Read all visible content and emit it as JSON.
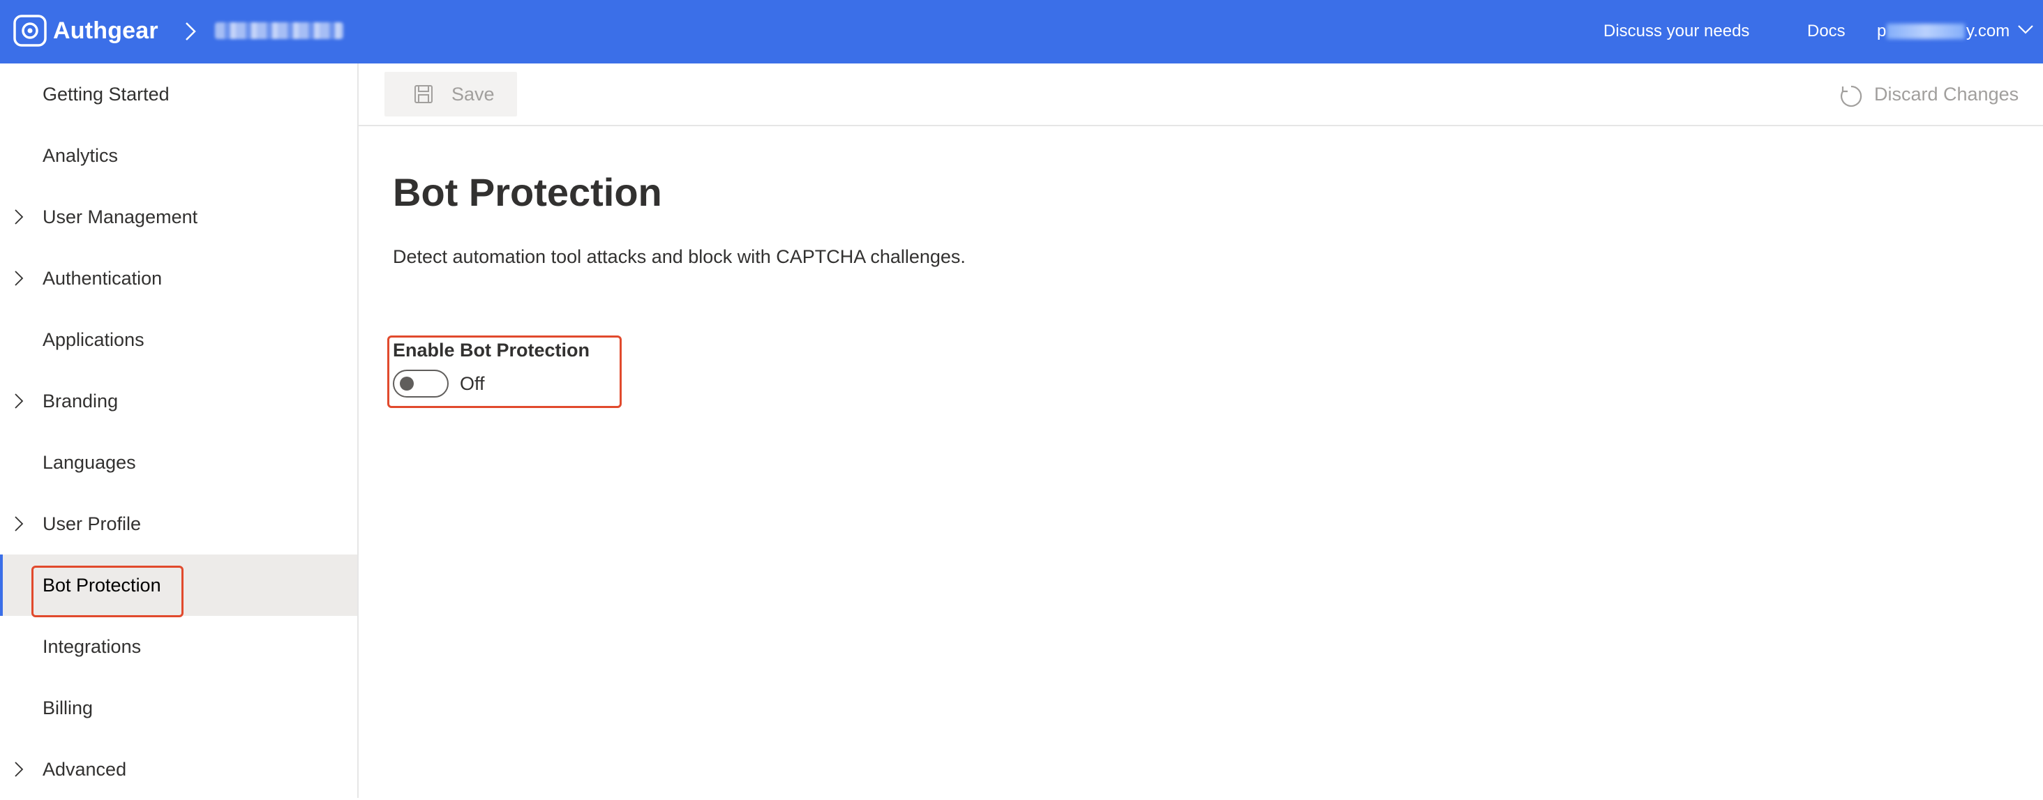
{
  "header": {
    "brand": "Authgear",
    "links": [
      "Discuss your needs",
      "Docs"
    ],
    "account_prefix": "p",
    "account_suffix": "y.com"
  },
  "sidebar": {
    "items": [
      {
        "label": "Getting Started",
        "expandable": false
      },
      {
        "label": "Analytics",
        "expandable": false
      },
      {
        "label": "User Management",
        "expandable": true
      },
      {
        "label": "Authentication",
        "expandable": true
      },
      {
        "label": "Applications",
        "expandable": false
      },
      {
        "label": "Branding",
        "expandable": true
      },
      {
        "label": "Languages",
        "expandable": false
      },
      {
        "label": "User Profile",
        "expandable": true
      },
      {
        "label": "Bot Protection",
        "expandable": false,
        "active": true
      },
      {
        "label": "Integrations",
        "expandable": false
      },
      {
        "label": "Billing",
        "expandable": false
      },
      {
        "label": "Advanced",
        "expandable": true
      }
    ]
  },
  "toolbar": {
    "save_label": "Save",
    "discard_label": "Discard Changes"
  },
  "main": {
    "title": "Bot Protection",
    "description": "Detect automation tool attacks and block with CAPTCHA challenges.",
    "toggle_label": "Enable Bot Protection",
    "toggle_state": "Off",
    "toggle_on": false
  },
  "colors": {
    "header_bg": "#3b6fe8",
    "highlight": "#e14a2d",
    "active_nav_bg": "#edebe9"
  }
}
